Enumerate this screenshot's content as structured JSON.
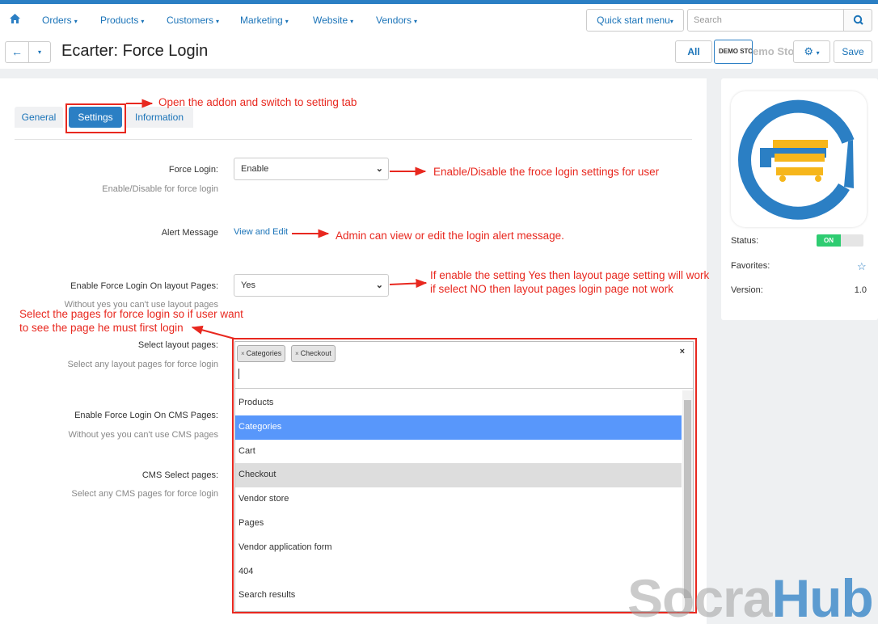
{
  "nav": {
    "menus": [
      {
        "label": "Orders"
      },
      {
        "label": "Products"
      },
      {
        "label": "Customers"
      },
      {
        "label": "Marketing"
      },
      {
        "label": "Website"
      },
      {
        "label": "Vendors"
      }
    ],
    "quick_start": "Quick start menu",
    "search_placeholder": "Search"
  },
  "header": {
    "title": "Ecarter: Force Login",
    "all": "All",
    "demo_store": "DEMO STO",
    "demo_store_ghost": "emo Sto",
    "save": "Save"
  },
  "tabs": {
    "general": "General",
    "settings": "Settings",
    "information": "Information"
  },
  "form": {
    "force_login_label": "Force Login:",
    "force_login_value": "Enable",
    "force_login_hint": "Enable/Disable for force login",
    "alert_label": "Alert Message",
    "alert_link": "View and Edit",
    "layout_label": "Enable Force Login On layout Pages:",
    "layout_value": "Yes",
    "layout_hint": "Without yes you can't use layout pages",
    "select_layout_label": "Select layout pages:",
    "select_layout_hint": "Select any layout pages for force login",
    "cms_label": "Enable Force Login On CMS Pages:",
    "cms_hint": "Without yes you can't use CMS pages",
    "cms_select_label": "CMS Select pages:",
    "cms_select_hint": "Select any CMS pages for force login"
  },
  "multiselect": {
    "chips": [
      "Categories",
      "Checkout"
    ],
    "clear": "×",
    "options": [
      "Products",
      "Categories",
      "Cart",
      "Checkout",
      "Vendor store",
      "Pages",
      "Vendor application form",
      "404",
      "Search results"
    ],
    "highlighted": "Categories",
    "selected": "Checkout"
  },
  "sidebar": {
    "status_label": "Status:",
    "status_value": "ON",
    "favorites_label": "Favorites:",
    "version_label": "Version:",
    "version_value": "1.0"
  },
  "annotations": {
    "tab": "Open the addon and switch to setting tab",
    "force_login": "Enable/Disable the froce login settings for user",
    "alert": "Admin can view or edit the login alert message.",
    "layout_1": "If enable the setting Yes then layout page setting will work",
    "layout_2": "if select NO then layout pages login page not work",
    "pages_1": "Select the pages for force login so if user want",
    "pages_2": "to see the page he must first login"
  },
  "watermark": {
    "part1": "Socra",
    "part2": "Hub"
  },
  "colors": {
    "accent": "#2b7fc4",
    "annotation": "#e8281f",
    "toggle_on": "#2ecc71",
    "highlight": "#5897fb"
  }
}
